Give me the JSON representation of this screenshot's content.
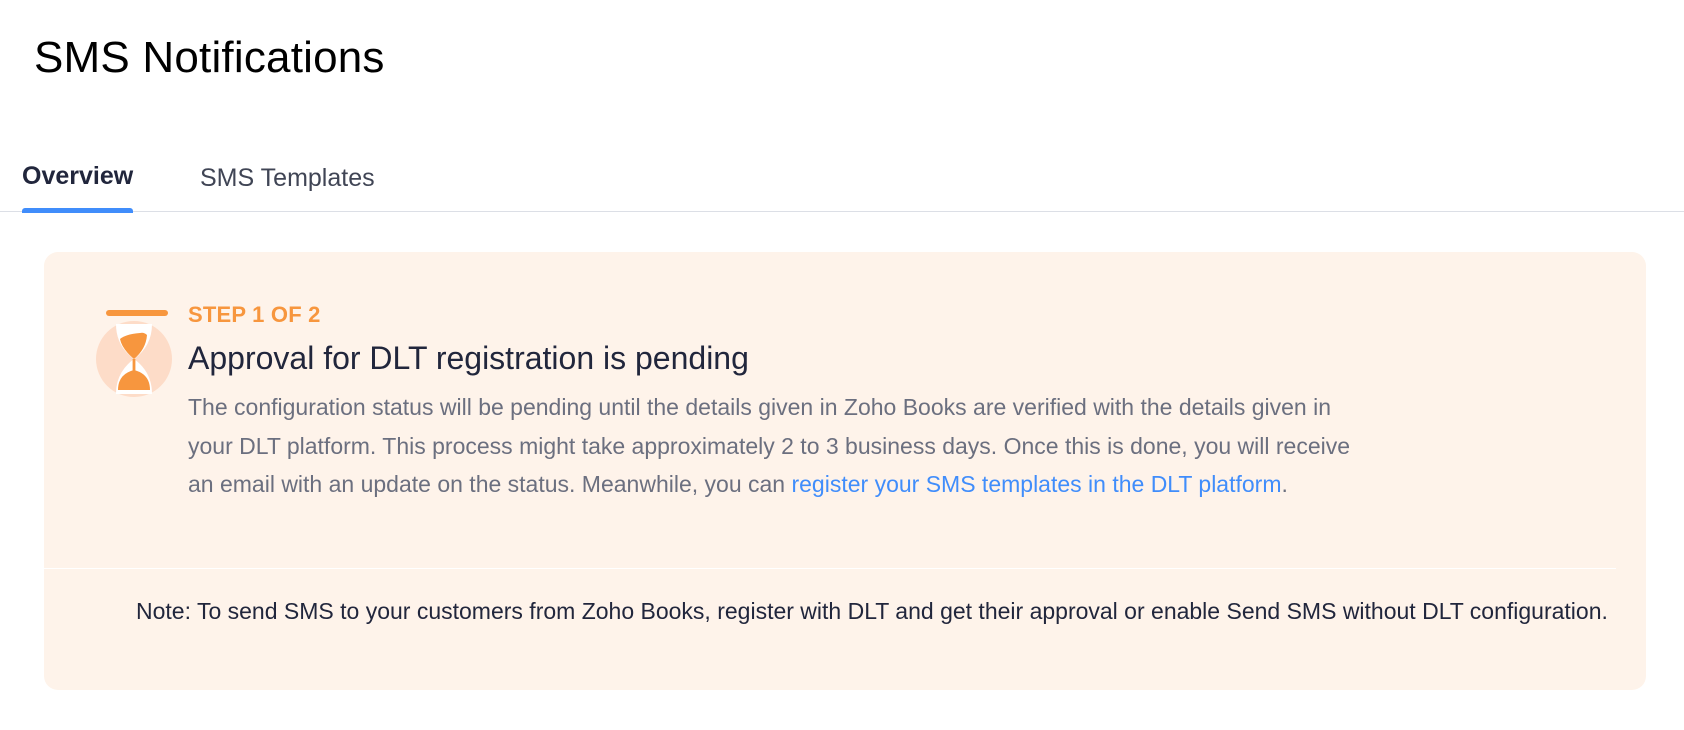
{
  "page": {
    "title": "SMS Notifications"
  },
  "tabs": [
    {
      "label": "Overview",
      "active": true
    },
    {
      "label": "SMS Templates",
      "active": false
    }
  ],
  "status_card": {
    "icon": "hourglass-icon",
    "step": "STEP 1 OF 2",
    "title": "Approval for DLT registration is pending",
    "description": "The configuration status will be pending until the details given in Zoho Books are verified with the details given in your DLT platform. This process might take approximately 2 to 3 business days. Once this is done, you will receive an email with an update on the status. Meanwhile, you can ",
    "link_text": "register your SMS templates in the DLT platform",
    "description_end": ".",
    "note": "Note: To send SMS to your customers from Zoho Books, register with DLT and get their approval or enable Send SMS without DLT configuration."
  },
  "colors": {
    "accent": "#408dfb",
    "step": "#f7963e",
    "card_background": "#fef3ea"
  }
}
